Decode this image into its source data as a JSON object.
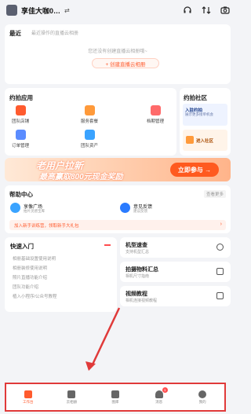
{
  "header": {
    "shop_name": "享佳大咖0…",
    "swap_label": "⇄"
  },
  "recent": {
    "title": "最近",
    "hint": "最近操作的直播云相册",
    "empty_text": "您还没有创建直播云相册哦~",
    "create_label": "+ 创建直播云相册"
  },
  "apps": {
    "title": "约拍应用",
    "items": [
      {
        "label": "团队店铺",
        "color": "#ff5b2e"
      },
      {
        "label": "服务套餐",
        "color": "#ff9a3a"
      },
      {
        "label": "档期管理",
        "color": "#ff6a6a"
      },
      {
        "label": "订单管理",
        "color": "#5b8cff"
      },
      {
        "label": "团队资产",
        "color": "#3aa3ff"
      }
    ]
  },
  "community": {
    "title": "约拍社区",
    "join_title": "入驻约拍",
    "join_sub": "展示更多接单机会",
    "enter_label": "进入社区"
  },
  "banner": {
    "line1": "老用户拉新",
    "line2": "最高赢取800元现金奖励",
    "cta": "立即参与 →"
  },
  "help": {
    "title": "帮助中心",
    "more": "查看更多",
    "items": [
      {
        "title": "享像广场",
        "sub": "拍片灵感宝库",
        "color": "#3aa3ff"
      },
      {
        "title": "意见反馈",
        "sub": "建议反馈",
        "color": "#2a7bff"
      }
    ],
    "newbie": "加入新手训练营，领取新手大礼包",
    "chev": "›"
  },
  "quick": {
    "title": "快速入门",
    "links": [
      "相册基础设置使用说明",
      "相册装修使用说明",
      "照片直播功能介绍",
      "团队功能介绍",
      "植入小程序/公众号教程"
    ]
  },
  "side_cards": [
    {
      "title": "机型速查",
      "sub": "支持机型汇总"
    },
    {
      "title": "拍摄物料汇总",
      "sub": "相机尺寸指南"
    },
    {
      "title": "视频教程",
      "sub": "相机连接视频教程"
    }
  ],
  "tabbar": {
    "tabs": [
      {
        "label": "工作台",
        "active": true
      },
      {
        "label": "云相册",
        "active": false
      },
      {
        "label": "图库",
        "active": false
      },
      {
        "label": "消息",
        "active": false,
        "badge": "1"
      },
      {
        "label": "我的",
        "active": false
      }
    ]
  },
  "colors": {
    "accent": "#ff5b2e",
    "highlight": "#e03a3a"
  }
}
